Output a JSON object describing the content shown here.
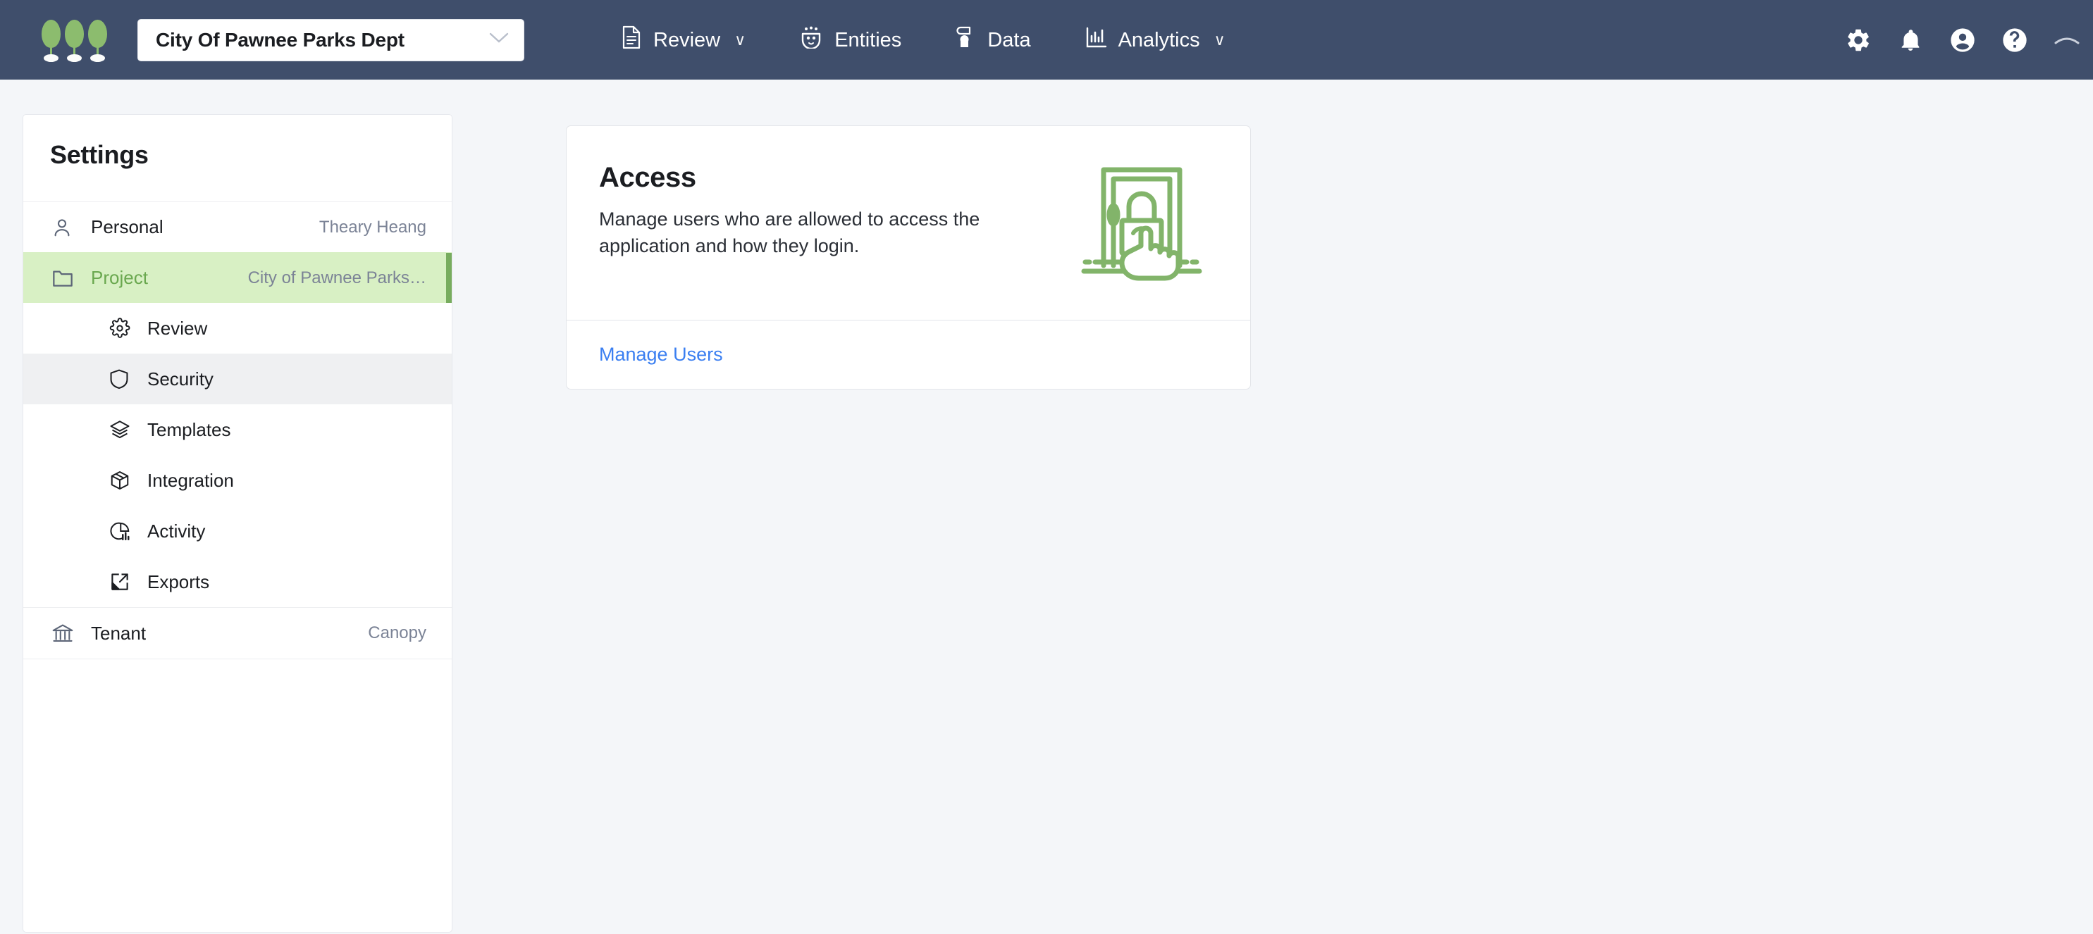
{
  "header": {
    "logo_name": "three-trees-logo",
    "project_selector": {
      "value": "City Of Pawnee Parks Dept",
      "chevron": "∨"
    },
    "nav": [
      {
        "label": "Review",
        "icon": "document-icon",
        "has_caret": true,
        "caret": "∨"
      },
      {
        "label": "Entities",
        "icon": "entities-icon",
        "has_caret": false,
        "caret": ""
      },
      {
        "label": "Data",
        "icon": "database-icon",
        "has_caret": false,
        "caret": ""
      },
      {
        "label": "Analytics",
        "icon": "bar-chart-icon",
        "has_caret": true,
        "caret": "∨"
      }
    ],
    "actions": [
      {
        "name": "settings-gear-icon"
      },
      {
        "name": "notifications-bell-icon"
      },
      {
        "name": "account-avatar-icon"
      },
      {
        "name": "help-question-icon"
      },
      {
        "name": "collapse-chevron-icon"
      }
    ]
  },
  "sidebar": {
    "title": "Settings",
    "rows": [
      {
        "label": "Personal",
        "value": "Theary Heang",
        "icon": "person-icon",
        "state": "default"
      },
      {
        "label": "Project",
        "value": "City of Pawnee Parks…",
        "icon": "folder-icon",
        "state": "selected"
      }
    ],
    "sub_items": [
      {
        "label": "Review",
        "icon": "gear-icon",
        "state": "default"
      },
      {
        "label": "Security",
        "icon": "shield-icon",
        "state": "active"
      },
      {
        "label": "Templates",
        "icon": "layers-icon",
        "state": "default"
      },
      {
        "label": "Integration",
        "icon": "box-icon",
        "state": "default"
      },
      {
        "label": "Activity",
        "icon": "pie-chart-icon",
        "state": "default"
      },
      {
        "label": "Exports",
        "icon": "export-icon",
        "state": "default"
      }
    ],
    "tenant": {
      "label": "Tenant",
      "value": "Canopy",
      "icon": "bank-icon"
    }
  },
  "main": {
    "card": {
      "title": "Access",
      "description": "Manage users who are allowed to access the application and how they login.",
      "illustration": "door-lock-hand-icon",
      "link_label": "Manage Users"
    }
  },
  "colors": {
    "header_bg": "#3f4e6b",
    "page_bg": "#f4f6f9",
    "accent_green": "#8cbc6e",
    "selected_green_bg": "#d8f0c4",
    "selected_green_bar": "#77ac5e",
    "active_grey_bg": "#eff0f2",
    "link_blue": "#3b7ff1",
    "illustration_green": "#82b46a"
  }
}
